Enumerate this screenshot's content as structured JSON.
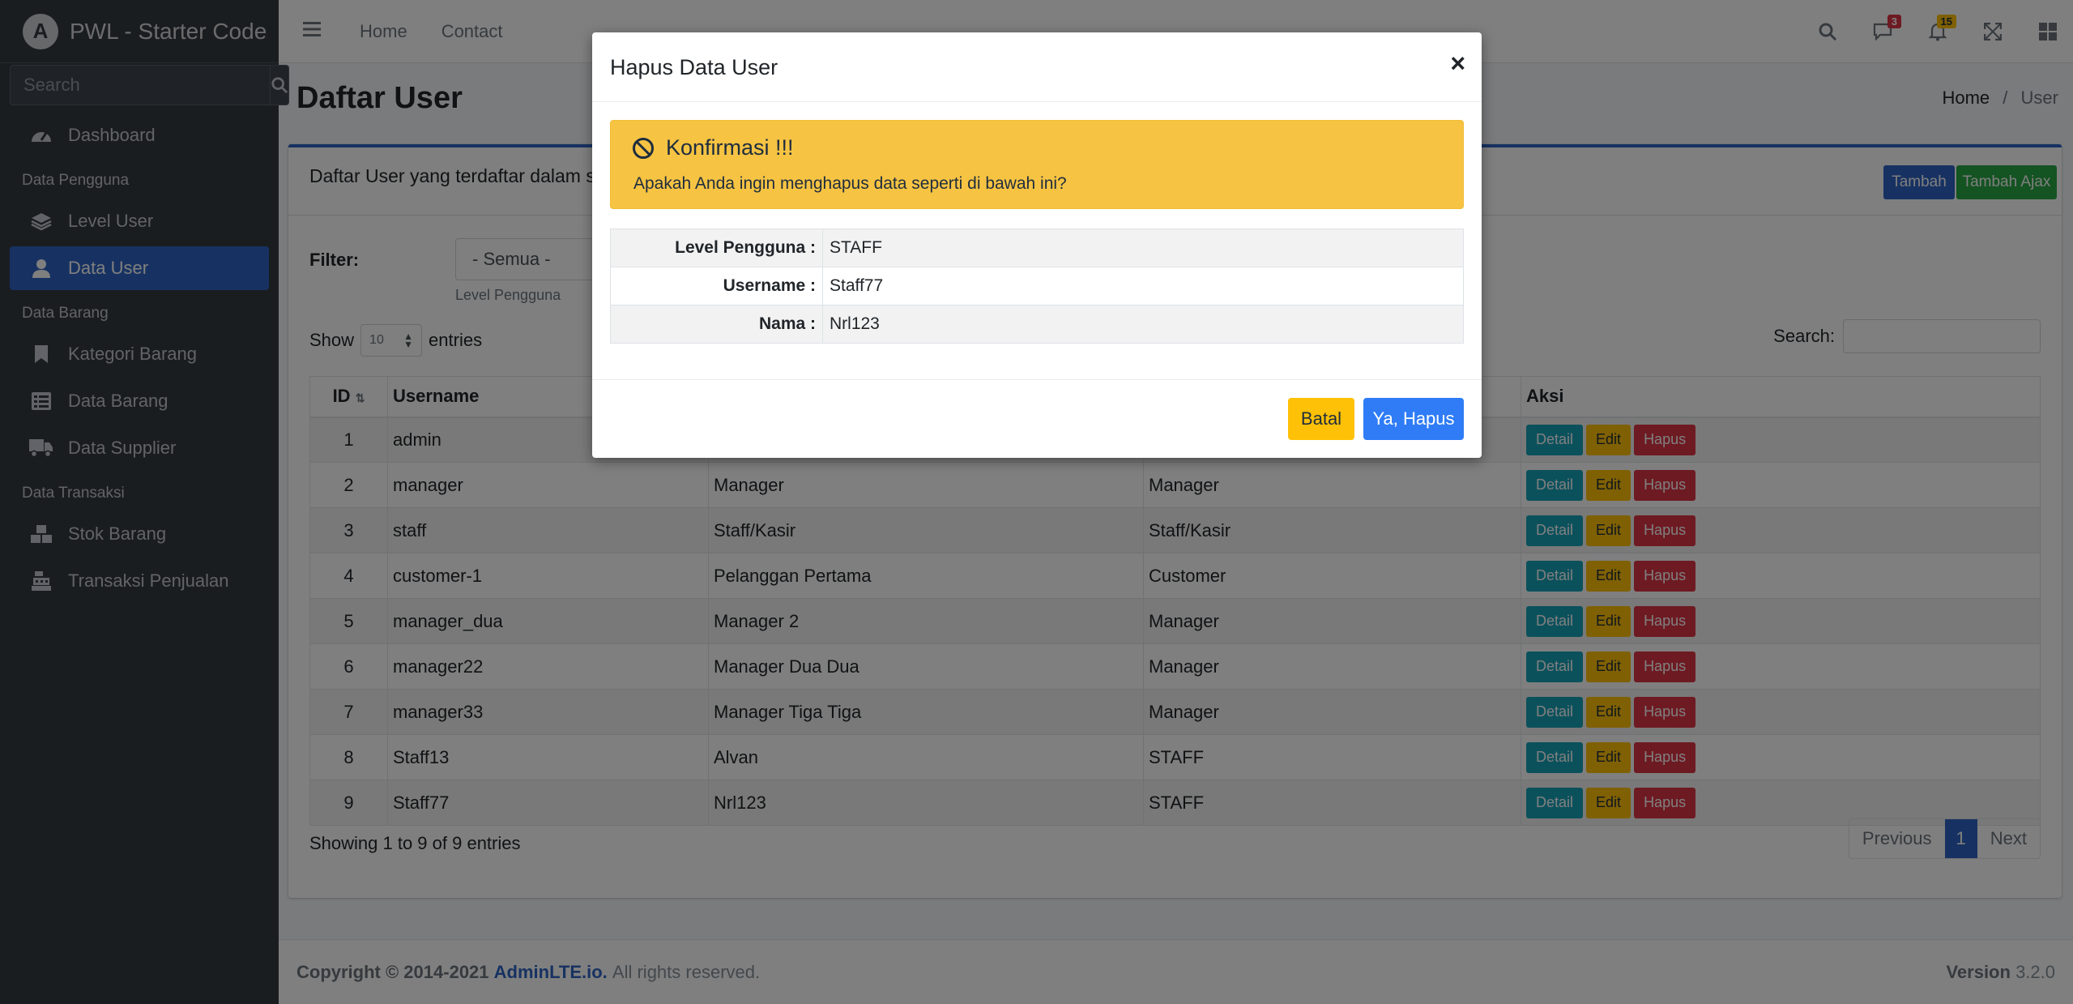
{
  "brand": {
    "logo_letter": "A",
    "name": "PWL - Starter Code"
  },
  "sidebar": {
    "search_placeholder": "Search",
    "sections": {
      "dashboard": "Dashboard",
      "data_pengguna": "Data Pengguna",
      "level_user": "Level User",
      "data_user": "Data User",
      "data_barang_header": "Data Barang",
      "kategori_barang": "Kategori Barang",
      "data_barang": "Data Barang",
      "data_supplier": "Data Supplier",
      "data_transaksi": "Data Transaksi",
      "stok_barang": "Stok Barang",
      "transaksi_penjualan": "Transaksi Penjualan"
    }
  },
  "topbar": {
    "links": {
      "home": "Home",
      "contact": "Contact"
    },
    "messages_badge": "3",
    "notifications_badge": "15"
  },
  "page": {
    "title": "Daftar User",
    "breadcrumb_home": "Home",
    "breadcrumb_sep": "/",
    "breadcrumb_current": "User"
  },
  "card": {
    "title": "Daftar User yang terdaftar dalam sistem",
    "btn_tambah": "Tambah",
    "btn_tambah_ajax": "Tambah Ajax",
    "filter_label": "Filter:",
    "filter_value": "- Semua -",
    "filter_help": "Level Pengguna",
    "show_label": "Show",
    "show_value": "10",
    "entries_label": "entries",
    "search_label": "Search:"
  },
  "table": {
    "headers": {
      "id": "ID",
      "username": "Username",
      "aksi": "Aksi"
    },
    "rows": [
      {
        "id": "1",
        "username": "admin",
        "nama": "",
        "level": ""
      },
      {
        "id": "2",
        "username": "manager",
        "nama": "Manager",
        "level": "Manager"
      },
      {
        "id": "3",
        "username": "staff",
        "nama": "Staff/Kasir",
        "level": "Staff/Kasir"
      },
      {
        "id": "4",
        "username": "customer-1",
        "nama": "Pelanggan Pertama",
        "level": "Customer"
      },
      {
        "id": "5",
        "username": "manager_dua",
        "nama": "Manager 2",
        "level": "Manager"
      },
      {
        "id": "6",
        "username": "manager22",
        "nama": "Manager Dua Dua",
        "level": "Manager"
      },
      {
        "id": "7",
        "username": "manager33",
        "nama": "Manager Tiga Tiga",
        "level": "Manager"
      },
      {
        "id": "8",
        "username": "Staff13",
        "nama": "Alvan",
        "level": "STAFF"
      },
      {
        "id": "9",
        "username": "Staff77",
        "nama": "Nrl123",
        "level": "STAFF"
      }
    ],
    "btn_detail": "Detail",
    "btn_edit": "Edit",
    "btn_hapus": "Hapus",
    "info": "Showing 1 to 9 of 9 entries",
    "pager": {
      "prev": "Previous",
      "current": "1",
      "next": "Next"
    }
  },
  "footer": {
    "copyright": "Copyright © 2014-2021",
    "link": "AdminLTE.io.",
    "rights": "All rights reserved.",
    "version_label": "Version",
    "version": "3.2.0"
  },
  "modal": {
    "title": "Hapus Data User",
    "close": "×",
    "alert_title": "Konfirmasi !!!",
    "alert_text": "Apakah Anda ingin menghapus data seperti di bawah ini?",
    "details": [
      {
        "label": "Level Pengguna :",
        "value": "STAFF"
      },
      {
        "label": "Username :",
        "value": "Staff77"
      },
      {
        "label": "Nama :",
        "value": "Nrl123"
      }
    ],
    "btn_batal": "Batal",
    "btn_ya": "Ya, Hapus"
  },
  "colors": {
    "primary": "#2f65c4",
    "sidebar": "#343a40",
    "warning": "#ffc107",
    "danger": "#dc3545",
    "info": "#17a2b8",
    "success": "#28a745"
  }
}
